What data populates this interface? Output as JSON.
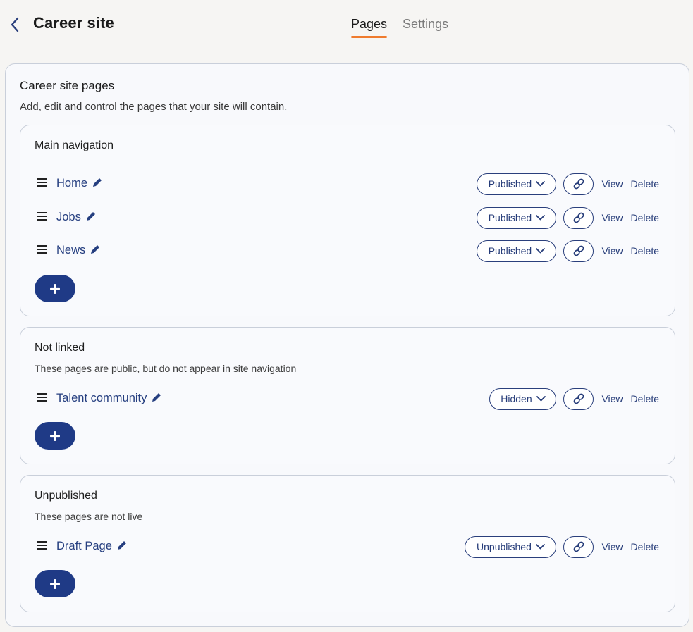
{
  "header": {
    "title": "Career site",
    "tabs": [
      {
        "label": "Pages",
        "active": true
      },
      {
        "label": "Settings",
        "active": false
      }
    ]
  },
  "main": {
    "title": "Career site pages",
    "subtitle": "Add, edit and control the pages that your site will contain."
  },
  "sections": [
    {
      "title": "Main navigation",
      "description": "",
      "pages": [
        {
          "name": "Home",
          "status": "Published"
        },
        {
          "name": "Jobs",
          "status": "Published"
        },
        {
          "name": "News",
          "status": "Published"
        }
      ]
    },
    {
      "title": "Not linked",
      "description": "These pages are public, but do not appear in site navigation",
      "pages": [
        {
          "name": "Talent community",
          "status": "Hidden"
        }
      ]
    },
    {
      "title": "Unpublished",
      "description": "These pages are not live",
      "pages": [
        {
          "name": "Draft Page",
          "status": "Unpublished"
        }
      ]
    }
  ],
  "actions": {
    "view": "View",
    "delete": "Delete"
  },
  "icons": {
    "back": "chevron-left-icon",
    "drag": "drag-handle-icon",
    "edit": "pencil-icon",
    "status": "chevron-down-icon",
    "link": "link-icon",
    "add": "plus-icon"
  },
  "colors": {
    "accent": "#ef7b2e",
    "primary": "#1f3a86",
    "link": "#263f80"
  }
}
